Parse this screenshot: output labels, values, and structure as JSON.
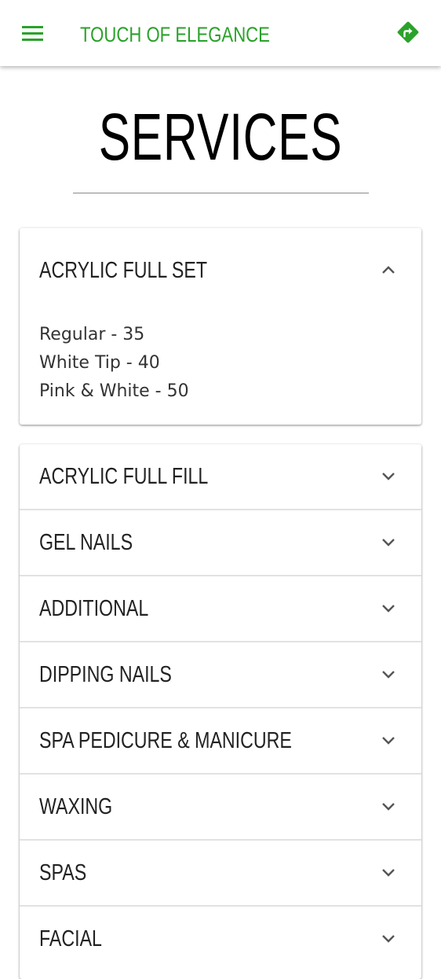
{
  "header": {
    "menu_icon": "hamburger-menu-icon",
    "title": "TOUCH OF ELEGANCE",
    "directions_icon": "directions-icon",
    "accent_color": "#2aa22a"
  },
  "page": {
    "title": "SERVICES"
  },
  "services": {
    "expanded": {
      "title": "ACRYLIC FULL SET",
      "icon": "chevron-up-icon",
      "items": [
        "Regular - 35",
        "White Tip - 40",
        "Pink & White - 50"
      ]
    },
    "collapsed": [
      {
        "title": "ACRYLIC FULL FILL",
        "icon": "chevron-down-icon"
      },
      {
        "title": "GEL NAILS",
        "icon": "chevron-down-icon"
      },
      {
        "title": "ADDITIONAL",
        "icon": "chevron-down-icon"
      },
      {
        "title": "DIPPING NAILS",
        "icon": "chevron-down-icon"
      },
      {
        "title": "SPA PEDICURE & MANICURE",
        "icon": "chevron-down-icon"
      },
      {
        "title": "WAXING",
        "icon": "chevron-down-icon"
      },
      {
        "title": "SPAS",
        "icon": "chevron-down-icon"
      },
      {
        "title": "FACIAL",
        "icon": "chevron-down-icon"
      }
    ]
  }
}
